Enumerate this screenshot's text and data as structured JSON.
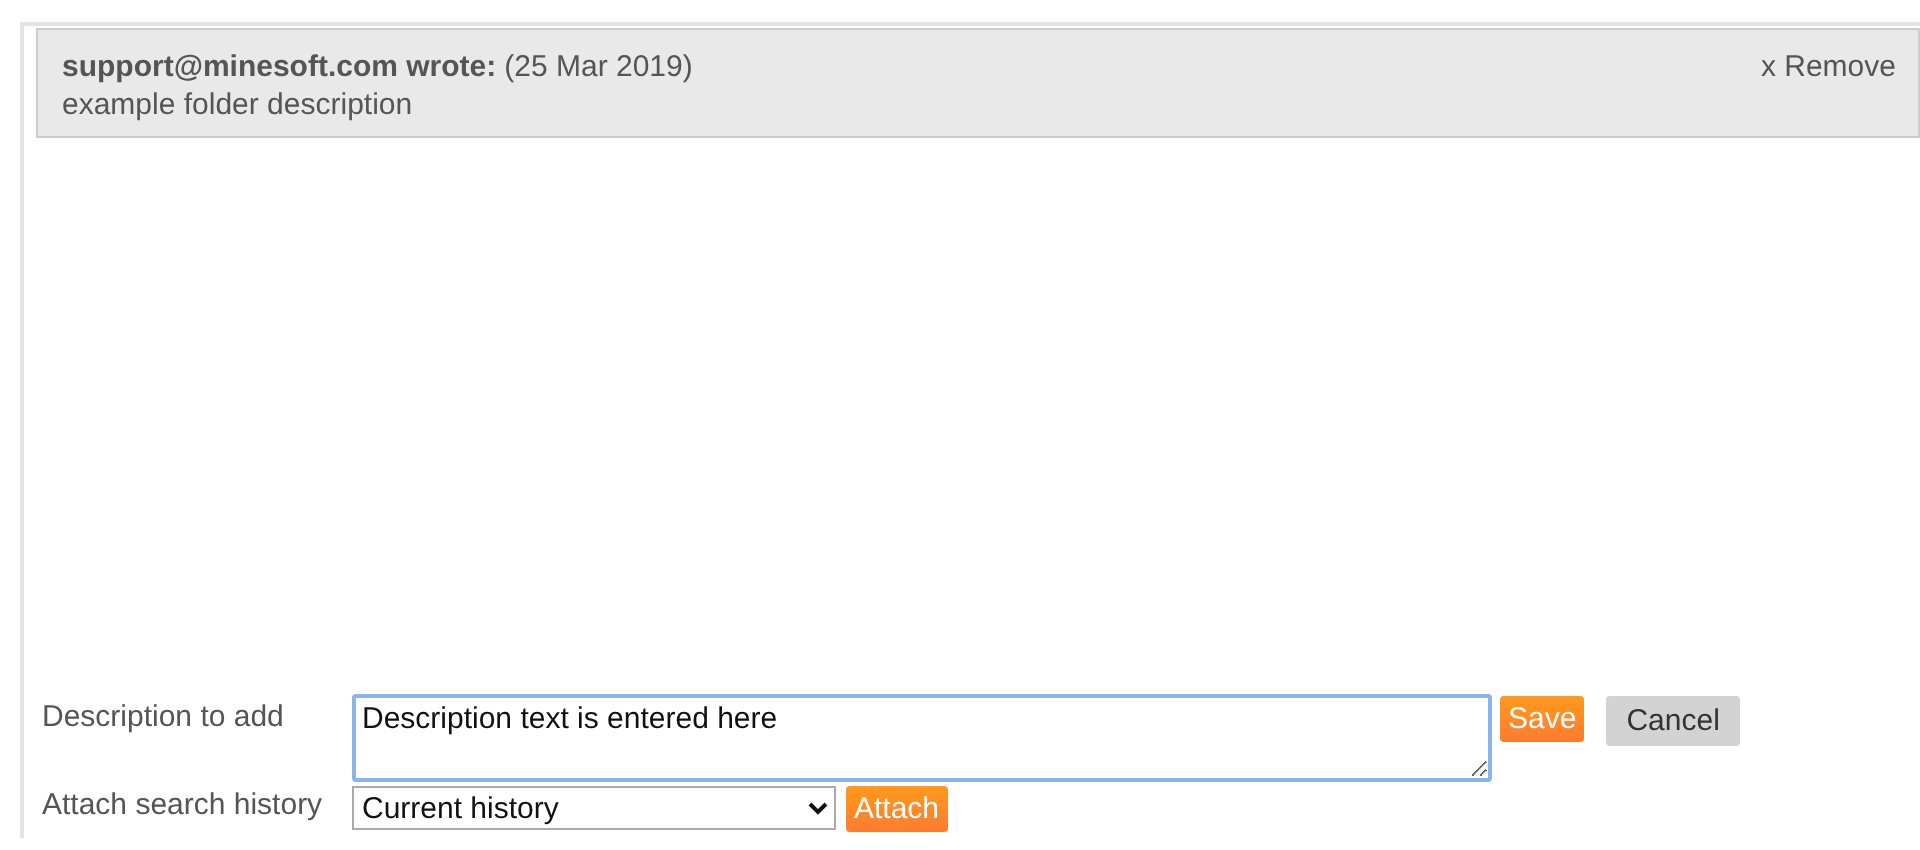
{
  "comments": [
    {
      "author": "support@minesoft.com wrote:",
      "date": "(25 Mar 2019)",
      "text": "example folder description",
      "remove": "x Remove"
    }
  ],
  "form": {
    "description_label": "Description to add",
    "description_value": "Description text is entered here",
    "save": "Save",
    "cancel": "Cancel",
    "history_label": "Attach search history",
    "history_value": "Current history",
    "attach": "Attach"
  }
}
